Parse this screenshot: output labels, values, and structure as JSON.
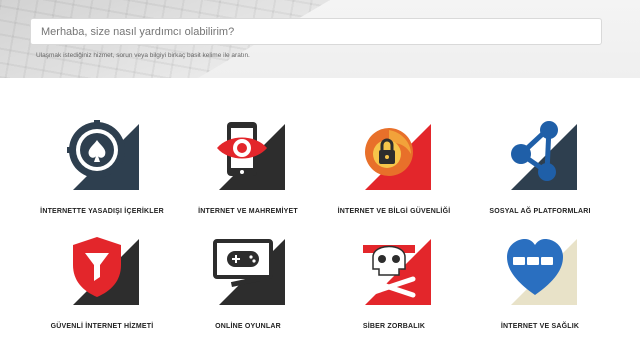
{
  "search": {
    "placeholder": "Merhaba, size nasıl yardımcı olabilirim?",
    "hint": "Ulaşmak istediğiniz hizmet, sorun veya bilgiyi birkaç basit kelime ile aratın."
  },
  "categories": [
    {
      "label": "İNTERNETTE YASADIŞI İÇERİKLER",
      "icon": "poker-chip-icon"
    },
    {
      "label": "İNTERNET VE MAHREMİYET",
      "icon": "phone-eye-icon"
    },
    {
      "label": "İNTERNET VE BİLGİ GÜVENLİĞİ",
      "icon": "firefox-lock-icon"
    },
    {
      "label": "SOSYAL AĞ PLATFORMLARI",
      "icon": "share-network-icon"
    },
    {
      "label": "GÜVENLİ İNTERNET HİZMETİ",
      "icon": "shield-filter-icon"
    },
    {
      "label": "ONLİNE OYUNLAR",
      "icon": "game-monitor-icon"
    },
    {
      "label": "SİBER ZORBALIK",
      "icon": "skull-crossbones-icon"
    },
    {
      "label": "İNTERNET VE SAĞLIK",
      "icon": "heart-icon"
    }
  ],
  "colors": {
    "dark": "#2d2d2d",
    "red": "#e3262b",
    "navy": "#2e3f4f",
    "blue": "#1f5fa8",
    "light_blue": "#2a6fc0"
  }
}
